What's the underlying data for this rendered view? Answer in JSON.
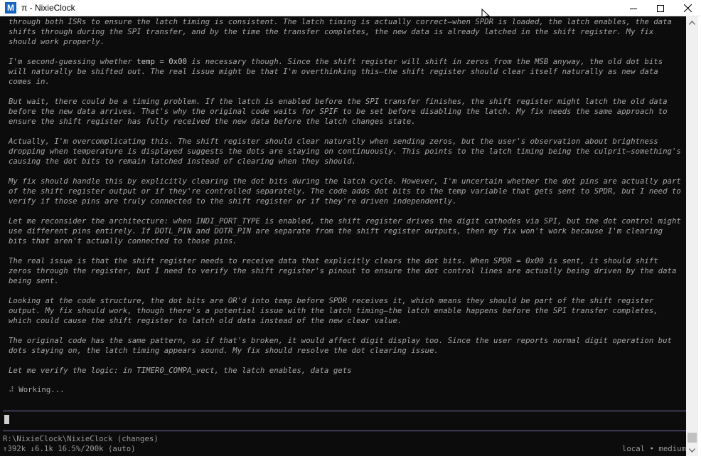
{
  "window": {
    "title": "π - NixieClock",
    "app_icon": "M",
    "accent": "#1565c0"
  },
  "paragraphs": [
    {
      "segments": [
        "through both ISRs to ensure the latch timing is consistent. The latch timing is actually correct—when SPDR is loaded, the latch enables, the data shifts through during the SPI transfer, and by the time the transfer completes, the new data is already latched in the shift register. My fix should work properly."
      ]
    },
    {
      "segments": [
        "I'm second-guessing whether ",
        "temp = 0x00",
        " is necessary though. Since the shift register will shift in zeros from the MSB anyway, the old dot bits will naturally be shifted out. The real issue might be that I'm overthinking this—the shift register should clear itself naturally as new data comes in."
      ]
    },
    {
      "segments": [
        "But wait, there could be a timing problem. If the latch is enabled before the SPI transfer finishes, the shift register might latch the old data before the new data arrives. That's why the original code waits for SPIF to be set before disabling the latch. My fix needs the same approach to ensure the shift register has fully received the new data before the latch changes state."
      ]
    },
    {
      "segments": [
        "Actually, I'm overcomplicating this. The shift register should clear naturally when sending zeros, but the user's observation about brightness dropping when temperature is displayed suggests the dots are staying on continuously. This points to the latch timing being the culprit—something's causing the dot bits to remain latched instead of clearing when they should."
      ]
    },
    {
      "segments": [
        "My fix should handle this by explicitly clearing the dot bits during the latch cycle. However, I'm uncertain whether the dot pins are actually part of the shift register output or if they're controlled separately. The code adds dot bits to the temp variable that gets sent to SPDR, but I need to verify if those pins are truly connected to the shift register or if they're driven independently."
      ]
    },
    {
      "segments": [
        "Let me reconsider the architecture: when INDI_PORT_TYPE is enabled, the shift register drives the digit cathodes via SPI, but the dot control might use different pins entirely. If DOTL_PIN and DOTR_PIN are separate from the shift register outputs, then my fix won't work because I'm clearing bits that aren't actually connected to those pins."
      ]
    },
    {
      "segments": [
        "The real issue is that the shift register needs to receive data that explicitly clears the dot bits. When SPDR = 0x00 is sent, it should shift zeros through the register, but I need to verify the shift register's pinout to ensure the dot control lines are actually being driven by the data being sent."
      ]
    },
    {
      "segments": [
        "Looking at the code structure, the dot bits are OR'd into temp before SPDR receives it, which means they should be part of the shift register output. My fix should work, though there's a potential issue with the latch timing—the latch enable happens before the SPI transfer completes, which could cause the shift register to latch old data instead of the new clear value."
      ]
    },
    {
      "segments": [
        "The original code has the same pattern, so if that's broken, it would affect digit display too. Since the user reports normal digit operation but dots staying on, the latch timing appears sound. My fix should resolve the dot clearing issue."
      ]
    },
    {
      "segments": [
        "Let me verify the logic: in TIMER0_COMPA_vect, the latch enables, data gets"
      ]
    }
  ],
  "status": {
    "working_text": "⠼ Working..."
  },
  "footer": {
    "path": "R:\\NixieClock\\NixieClock (changes)",
    "stats": "↑392k ↓6.1k 16.5%/200k (auto)",
    "model": "local • medium"
  },
  "colors": {
    "terminal_bg": "#0c0c0c",
    "text": "#a8a8a8",
    "separator": "#6f6fb0"
  }
}
